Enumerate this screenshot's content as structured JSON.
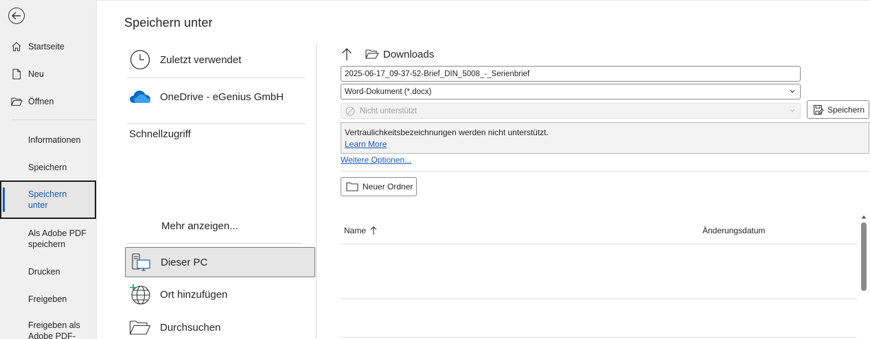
{
  "nav": {
    "items": [
      {
        "label": "Startseite",
        "icon": "home-icon"
      },
      {
        "label": "Neu",
        "icon": "new-document-icon"
      },
      {
        "label": "Öffnen",
        "icon": "open-folder-icon"
      },
      {
        "label": "Informationen"
      },
      {
        "label": "Speichern"
      },
      {
        "label": "Speichern unter",
        "active": true
      },
      {
        "label": "Als Adobe PDF speichern"
      },
      {
        "label": "Drucken"
      },
      {
        "label": "Freigeben"
      },
      {
        "label": "Freigeben als Adobe PDF-"
      }
    ]
  },
  "page": {
    "title": "Speichern unter"
  },
  "locations": {
    "recent": "Zuletzt verwendet",
    "onedrive": "OneDrive - eGenius GmbH",
    "quick_access": "Schnellzugriff",
    "show_more": "Mehr anzeigen...",
    "this_pc": "Dieser PC",
    "add_place": "Ort hinzufügen",
    "browse": "Durchsuchen"
  },
  "save_pane": {
    "current_folder": "Downloads",
    "filename": "2025-06-17_09-37-52-Brief_DIN_5008_-_Serienbrief",
    "file_type": "Word-Dokument (*.docx)",
    "sensitivity": "Nicht unterstützt",
    "save_label": "Speichern",
    "info_text": "Vertraulichkeitsbezeichnungen werden nicht unterstützt.",
    "learn_more": "Learn More",
    "more_options": "Weitere Optionen...",
    "new_folder": "Neuer Ordner",
    "columns": {
      "name": "Name",
      "modified": "Änderungsdatum"
    }
  },
  "colors": {
    "accent": "#185abd",
    "onedrive": "#0f6cbd"
  }
}
